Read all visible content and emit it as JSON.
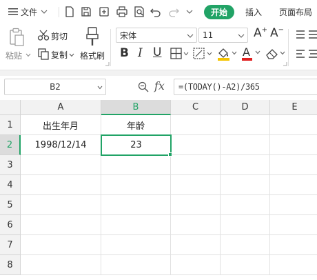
{
  "menu": {
    "file_label": "文件",
    "tabs": [
      {
        "label": "开始",
        "active": true
      },
      {
        "label": "插入",
        "active": false
      },
      {
        "label": "页面布局",
        "active": false
      }
    ]
  },
  "ribbon": {
    "paste_label": "粘贴",
    "cut_label": "剪切",
    "copy_label": "复制",
    "format_painter_label": "格式刷",
    "font_name": "宋体",
    "font_size": "11",
    "bold_glyph": "B",
    "italic_glyph": "I",
    "underline_glyph": "U",
    "font_color_glyph": "A",
    "grow_font_glyph": "A",
    "shrink_font_glyph": "A"
  },
  "formula_bar": {
    "name_box": "B2",
    "fx_label": "fx",
    "formula": "=(TODAY()-A2)/365"
  },
  "sheet": {
    "columns": [
      "A",
      "B",
      "C",
      "D",
      "E"
    ],
    "rows": [
      "1",
      "2",
      "3",
      "4",
      "5",
      "6",
      "7",
      "8"
    ],
    "active_cell": "B2",
    "cells": {
      "A1": "出生年月",
      "B1": "年龄",
      "A2": "1998/12/14",
      "B2": "23"
    }
  },
  "colors": {
    "accent": "#21a366",
    "font_color_bar": "#e02020",
    "fill_color_bar": "#f5c400"
  }
}
